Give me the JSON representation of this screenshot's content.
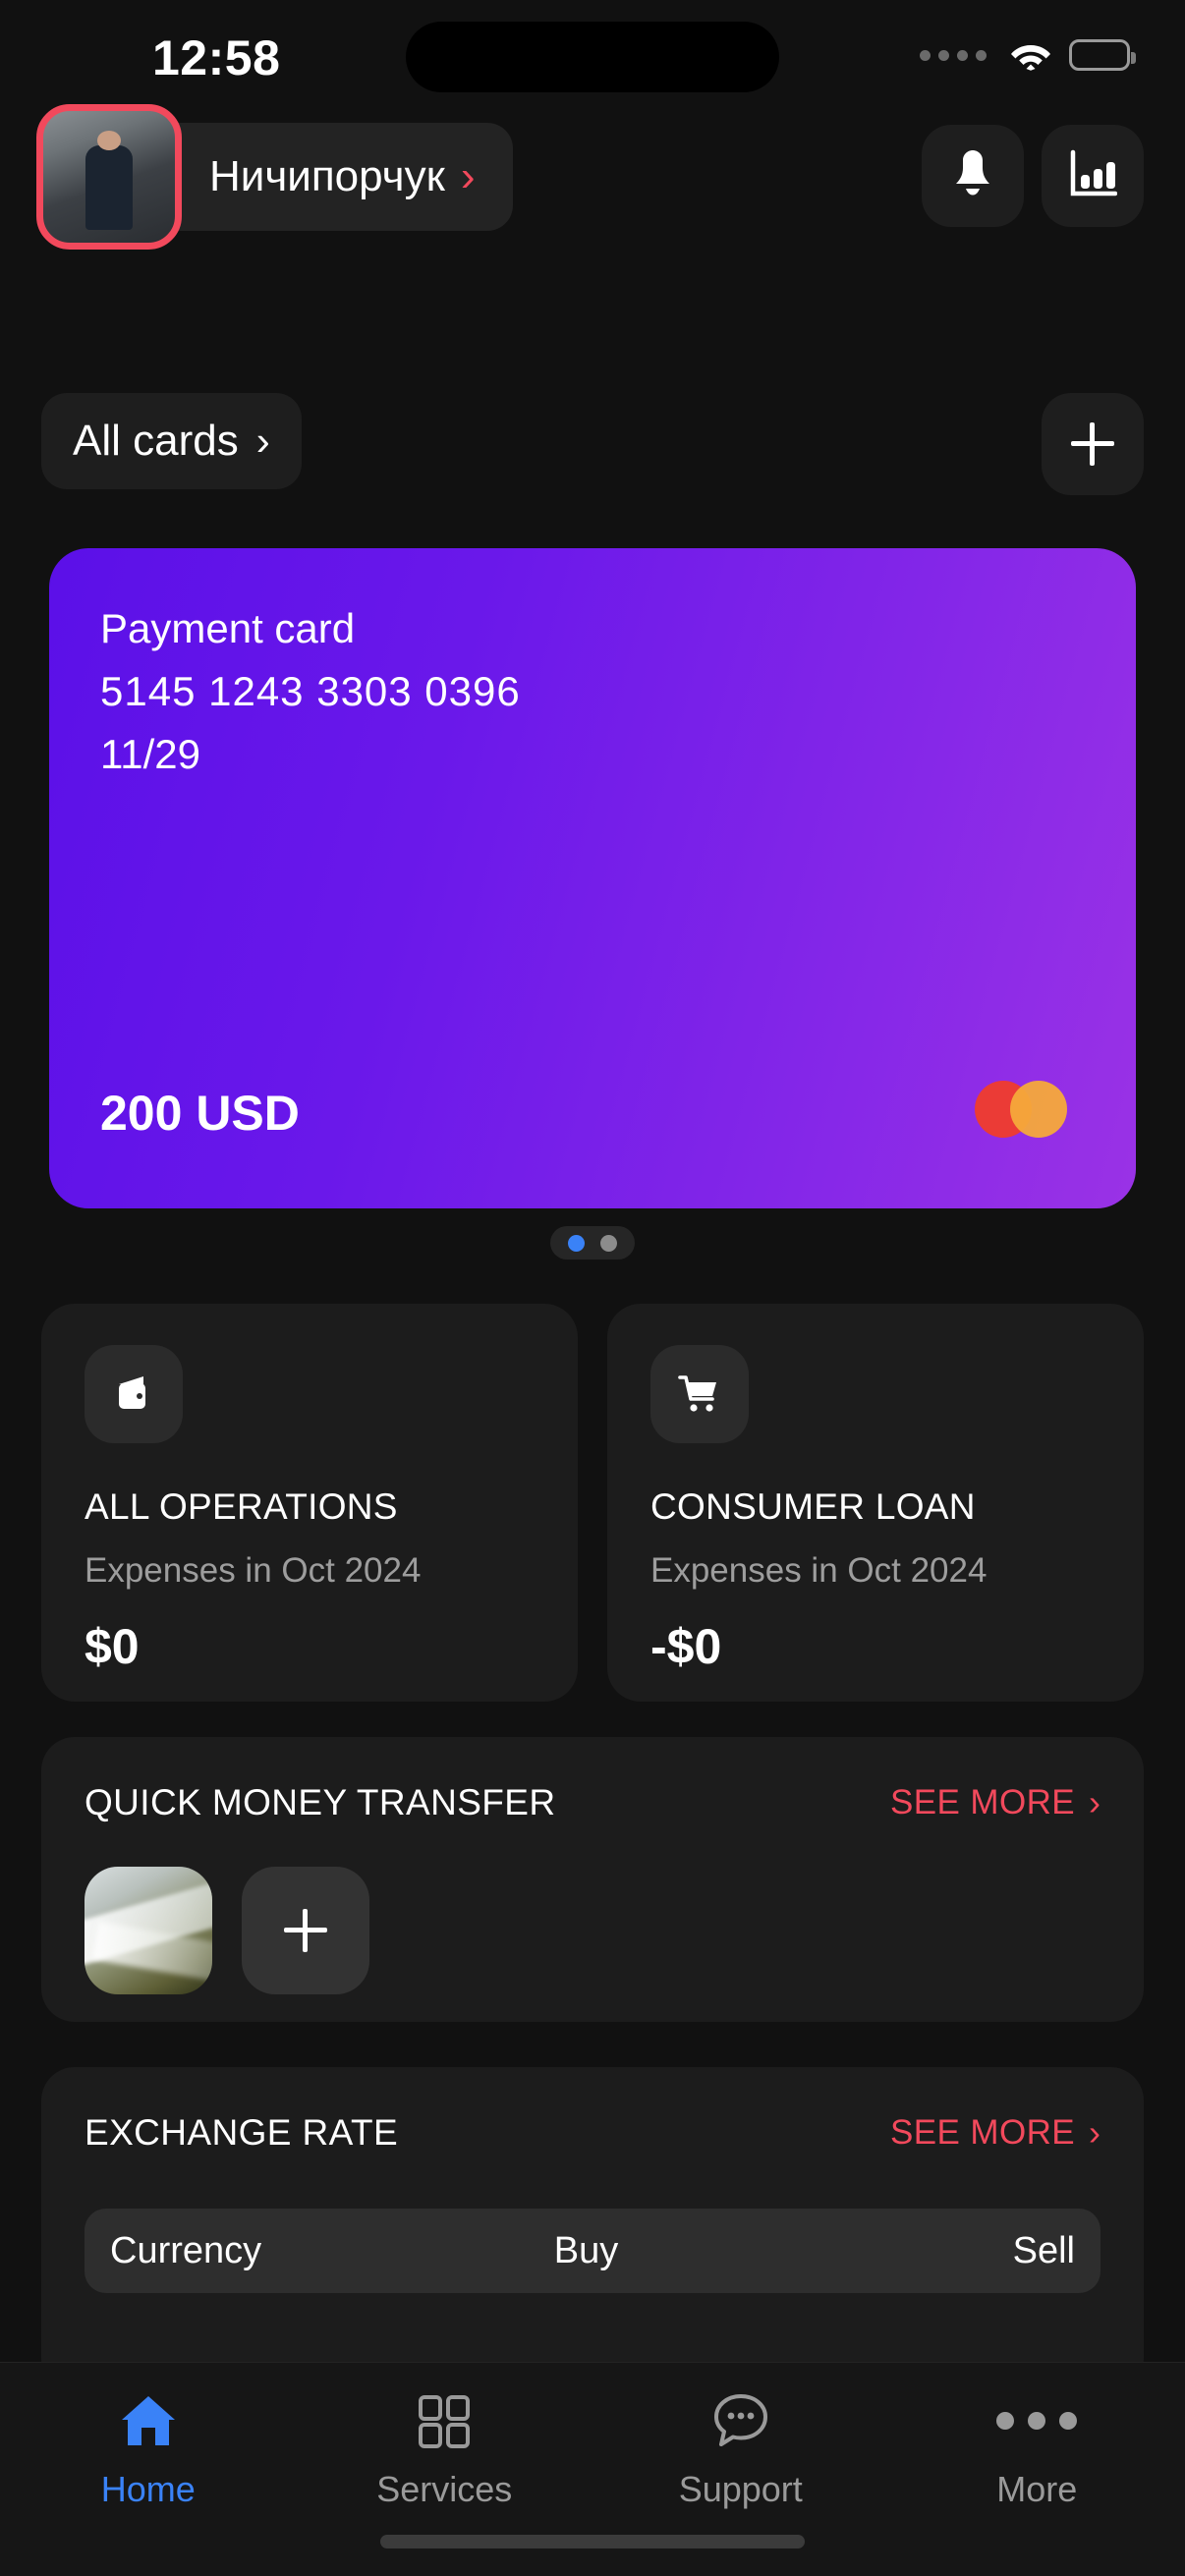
{
  "status_bar": {
    "time": "12:58",
    "signal_icon": "signal-dots-icon",
    "wifi_icon": "wifi-icon",
    "battery_icon": "battery-full-icon"
  },
  "header": {
    "profile_name": "Ничипорчук",
    "profile_chevron": "›",
    "avatar_icon": "user-avatar",
    "notifications_icon": "bell-icon",
    "analytics_icon": "bar-chart-icon"
  },
  "cards_bar": {
    "all_cards_label": "All cards",
    "all_cards_chevron": "›",
    "add_card_icon": "plus-icon"
  },
  "payment_card": {
    "title": "Payment card",
    "number": "5145 1243 3303 0396",
    "expiry": "11/29",
    "balance": "200 USD",
    "network_logo": "mastercard-logo",
    "gradient_from": "#5b10e8",
    "gradient_to": "#9a32e6"
  },
  "pager": {
    "active_index": 0,
    "total": 2,
    "active_color": "#3a82f7",
    "inactive_color": "#8c8c8c"
  },
  "stat_cards": [
    {
      "icon": "wallet-icon",
      "title": "ALL OPERATIONS",
      "subtitle": "Expenses in Oct 2024",
      "value": "$0"
    },
    {
      "icon": "shopping-cart-icon",
      "title": "CONSUMER LOAN",
      "subtitle": "Expenses in Oct 2024",
      "value": "-$0"
    }
  ],
  "quick_transfer": {
    "title": "QUICK MONEY TRANSFER",
    "see_more_label": "SEE MORE",
    "see_more_chevron": "›",
    "contact_avatar": "contact-photo",
    "add_icon": "plus-icon"
  },
  "exchange_rate": {
    "title": "EXCHANGE RATE",
    "see_more_label": "SEE MORE",
    "see_more_chevron": "›",
    "columns": [
      "Currency",
      "Buy",
      "Sell"
    ]
  },
  "tab_bar": {
    "items": [
      {
        "label": "Home",
        "icon": "home-icon",
        "active": true
      },
      {
        "label": "Services",
        "icon": "grid-icon",
        "active": false
      },
      {
        "label": "Support",
        "icon": "chat-bubble-icon",
        "active": false
      },
      {
        "label": "More",
        "icon": "ellipsis-icon",
        "active": false
      }
    ],
    "active_color": "#3a82f7",
    "inactive_color": "#9a9a9a"
  },
  "accent_colors": {
    "red": "#f2495c",
    "blue": "#3a82f7",
    "purple": "#7b1ae8"
  }
}
